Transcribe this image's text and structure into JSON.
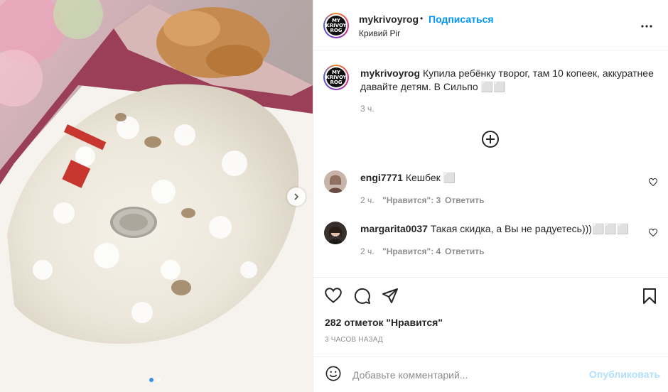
{
  "post": {
    "author": "mykrivoyrog",
    "follow_separator": "•",
    "follow_label": "Подписаться",
    "location": "Кривий Ріг",
    "avatar_logo_lines": [
      "MY",
      "KRIVOY",
      "ROG"
    ],
    "more_icon": "more-horizontal-icon"
  },
  "caption": {
    "username": "mykrivoyrog",
    "text": "Купила ребёнку творог, там 10 копеек, аккуратнее давайте детям. В Сильпо ⬜⬜",
    "time": "3 ч."
  },
  "load_more_icon": "plus-circle-icon",
  "comments": [
    {
      "username": "engi7771",
      "text": "Кешбек ⬜",
      "time": "2 ч.",
      "likes": "\"Нравится\": 3",
      "reply": "Ответить"
    },
    {
      "username": "margarita0037",
      "text": "Такая скидка, а Вы не радуетесь)))⬜⬜⬜",
      "time": "2 ч.",
      "likes": "\"Нравится\": 4",
      "reply": "Ответить"
    }
  ],
  "actions": {
    "icons": [
      "heart-icon",
      "comment-icon",
      "share-icon",
      "bookmark-icon"
    ],
    "likes_text": "282 отметок \"Нравится\"",
    "posted_ago": "3 ЧАСОВ НАЗАД"
  },
  "add_comment": {
    "emoji_icon": "emoji-icon",
    "placeholder": "Добавьте комментарий...",
    "publish_label": "Опубликовать"
  },
  "carousel": {
    "current": 1,
    "total": 2
  }
}
